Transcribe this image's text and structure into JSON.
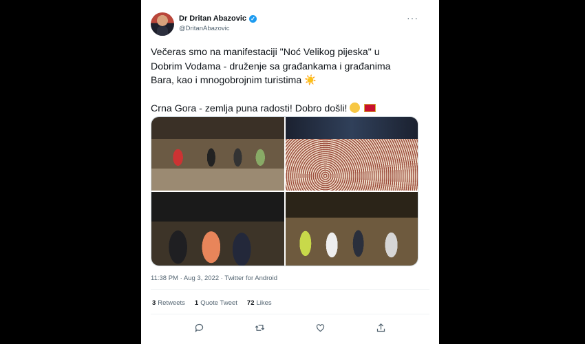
{
  "tweet": {
    "author": {
      "display_name": "Dr Dritan Abazovic",
      "handle": "@DritanAbazovic",
      "verified_icon": "verified-badge-icon"
    },
    "more_label": "···",
    "text": {
      "line1": "Večeras smo na manifestaciji \"Noć Velikog pijeska\" u",
      "line2": "Dobrim Vodama - druženje sa građankama i građanima",
      "line3": "Bara, kao i mnogobrojnim turistima",
      "sun": "☀️",
      "line4": "Crna Gora - zemlja puna radosti! Dobro došli!"
    },
    "time": "11:38 PM",
    "date": "Aug 3, 2022",
    "source": "Twitter for Android",
    "stats": {
      "retweets": "3",
      "retweets_label": "Retweets",
      "quotes": "1",
      "quotes_label": "Quote Tweet",
      "likes": "72",
      "likes_label": "Likes"
    },
    "actions": [
      "reply-icon",
      "retweet-icon",
      "like-icon",
      "share-icon"
    ]
  },
  "colors": {
    "text": "#0f1419",
    "muted": "#536471",
    "verified": "#1d9bf0"
  }
}
